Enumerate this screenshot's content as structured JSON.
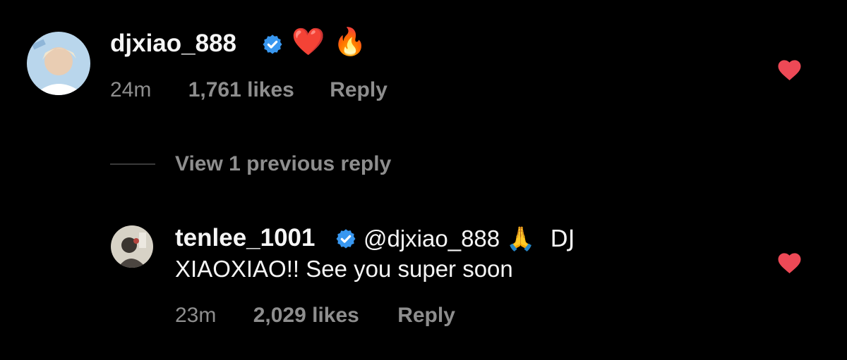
{
  "comment": {
    "username": "djxiao_888",
    "emojis": "❤️ 🔥",
    "time": "24m",
    "likes": "1,761 likes",
    "reply_label": "Reply"
  },
  "view_replies": "View 1 previous reply",
  "reply": {
    "username": "tenlee_1001",
    "mention": "@djxiao_888",
    "text_line1_suffix": "🙏  DJ",
    "text_line2": "XIAOXIAO!! See you super soon",
    "time": "23m",
    "likes": "2,029 likes",
    "reply_label": "Reply"
  },
  "colors": {
    "background": "#000000",
    "secondary_text": "#8e8e8e",
    "verified_blue": "#3897f0",
    "like_red": "#ed4956"
  },
  "icons": [
    "verified-badge-icon",
    "heart-like-icon"
  ]
}
